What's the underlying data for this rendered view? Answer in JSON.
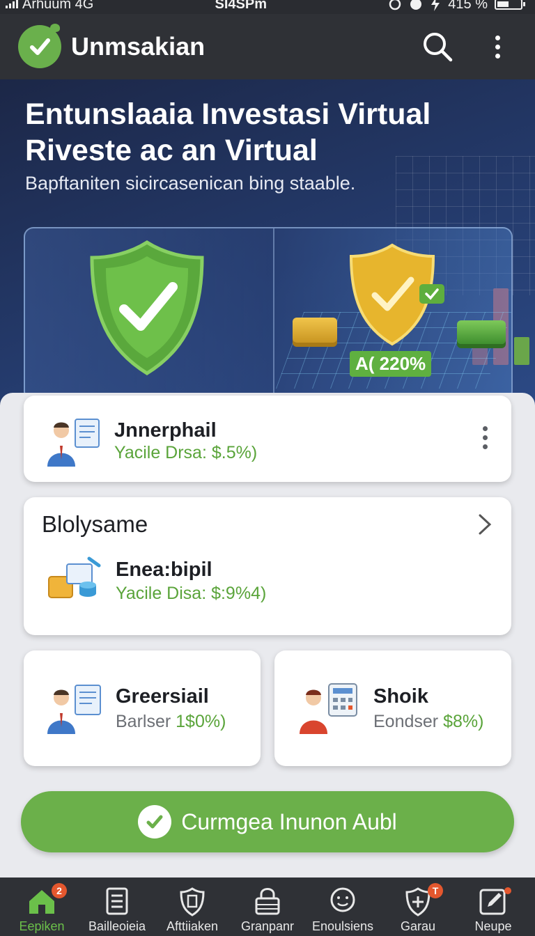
{
  "status_bar": {
    "carrier": "Arhuum 4G",
    "time": "SI4SPm",
    "battery": "415 %"
  },
  "app_bar": {
    "title": "Unmsakian",
    "icons": [
      "logo-check-icon",
      "search-icon",
      "more-vertical-icon"
    ]
  },
  "hero": {
    "title_line1": "Entunslaaia Investasi Virtual",
    "title_line2": "Riveste ac an Virtual",
    "subtitle": "Bapftaniten sicircasenican bing staable.",
    "badge": "A( 220%"
  },
  "cards": {
    "card1": {
      "name": "Jnnerphail",
      "yield": "Yacile Drsa: $.5%)"
    },
    "section": {
      "title": "Blolysame",
      "item_name": "Enea:bipil",
      "item_yield": "Yacile Disa: $:9%4)"
    },
    "card3": {
      "name": "Greersiail",
      "label": "Barlser",
      "yield": "1$0%)"
    },
    "card4": {
      "name": "Shoik",
      "label": "Eondser",
      "yield": "$8%)"
    }
  },
  "cta": {
    "label": "Curmgea Inunon Aubl"
  },
  "bottom_nav": {
    "items": [
      {
        "label": "Eepiken",
        "icon": "home-icon",
        "badge": "2",
        "active": true
      },
      {
        "label": "Bailleoieia",
        "icon": "document-list-icon"
      },
      {
        "label": "Afttiiaken",
        "icon": "shield-badge-icon"
      },
      {
        "label": "Granpanr",
        "icon": "lock-icon"
      },
      {
        "label": "Enoulsiens",
        "icon": "smile-face-icon"
      },
      {
        "label": "Garau",
        "icon": "shield-plus-icon",
        "badge": "T"
      },
      {
        "label": "Neupe",
        "icon": "edit-icon"
      }
    ]
  },
  "colors": {
    "accent_green": "#6bb04a",
    "app_bar": "#2f3136",
    "hero_blue": "#243a6b",
    "yield_green": "#5aa43a",
    "badge_red": "#e4572e"
  }
}
